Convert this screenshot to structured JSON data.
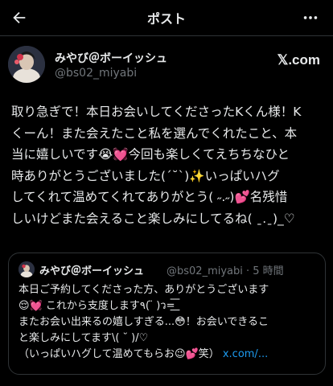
{
  "header": {
    "title": "ポスト",
    "back_icon": "arrow-left-icon",
    "more_icon": "more-dots-icon"
  },
  "author": {
    "name": "みやび＠ボーイッシュ",
    "handle": "@bs02_miyabi",
    "brand": "𝕏.com"
  },
  "tweet_lines": [
    "取り急ぎで！本日お会いしてくださったKくん様！K",
    "くーん！また会えたこと私を選んでくれたこと、本",
    "当に嬉しいです😭💓今回も楽しくてえちちなひと",
    "時ありがとうございました(´˘`)✨いっぱいハグ",
    "してくれて温めてくれてありがとう( ˶.˶)💕名残惜",
    "しいけどまた会えること楽しみにしてるね( ˍ.ˍ)_♡"
  ],
  "quote": {
    "name": "みやび＠ボーイッシュ",
    "handle_time": "@bs02_miyabi · 5 時間",
    "lines": [
      "本日ご予約してくださった方、ありがとうございます",
      "😌💓 これから支度します٩(  ̈ )ว=͟͟͞͞",
      "またお会い出来るの嬉しすぎる...😳！お会いできるこ",
      "と楽しみにしてます\\( ˘ )/♡",
      "（いっぱいハグして温めてもらお😉💕笑）"
    ],
    "link": "x.com/..."
  },
  "colors": {
    "background": "#000000",
    "text": "#e7e9ea",
    "muted": "#71767b",
    "border": "#2f3336",
    "link": "#1d9bf0"
  }
}
